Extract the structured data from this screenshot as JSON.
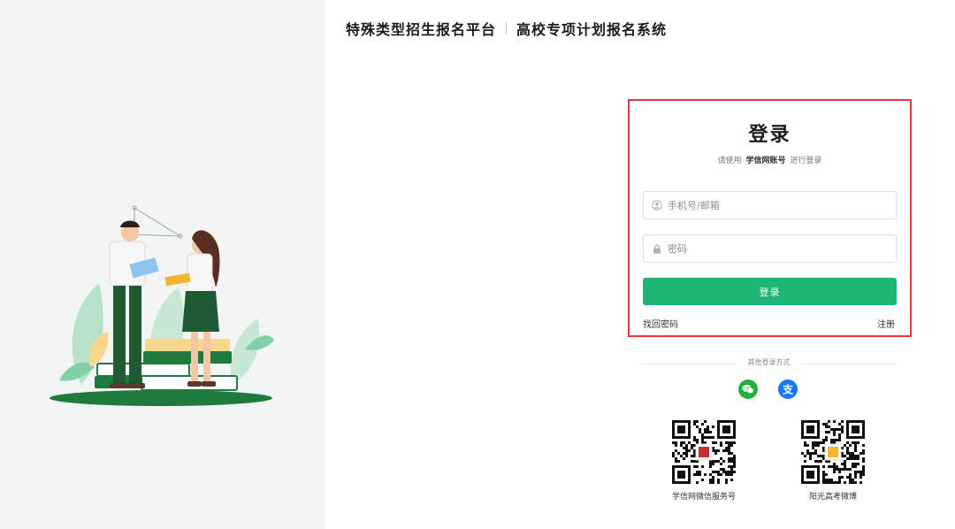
{
  "header": {
    "platform_title": "特殊类型招生报名平台",
    "system_title": "高校专项计划报名系统"
  },
  "login": {
    "title": "登录",
    "subtitle_prefix": "请使用",
    "subtitle_account": "学信网账号",
    "subtitle_suffix": "进行登录",
    "phone_placeholder": "手机号/邮箱",
    "password_placeholder": "密码",
    "submit_label": "登录",
    "forgot_label": "找回密码",
    "register_label": "注册"
  },
  "other_login": {
    "label": "其他登录方式",
    "methods": [
      {
        "icon": "wechat-icon",
        "color": "#1fb23b"
      },
      {
        "icon": "alipay-icon",
        "color": "#1677ff"
      }
    ]
  },
  "qrcodes": [
    {
      "label": "学信网微信服务号"
    },
    {
      "label": "阳光高考微博"
    }
  ],
  "colors": {
    "primary": "#1fb575",
    "highlight_border": "#e0393a",
    "left_panel_bg": "#f3f5f4"
  }
}
